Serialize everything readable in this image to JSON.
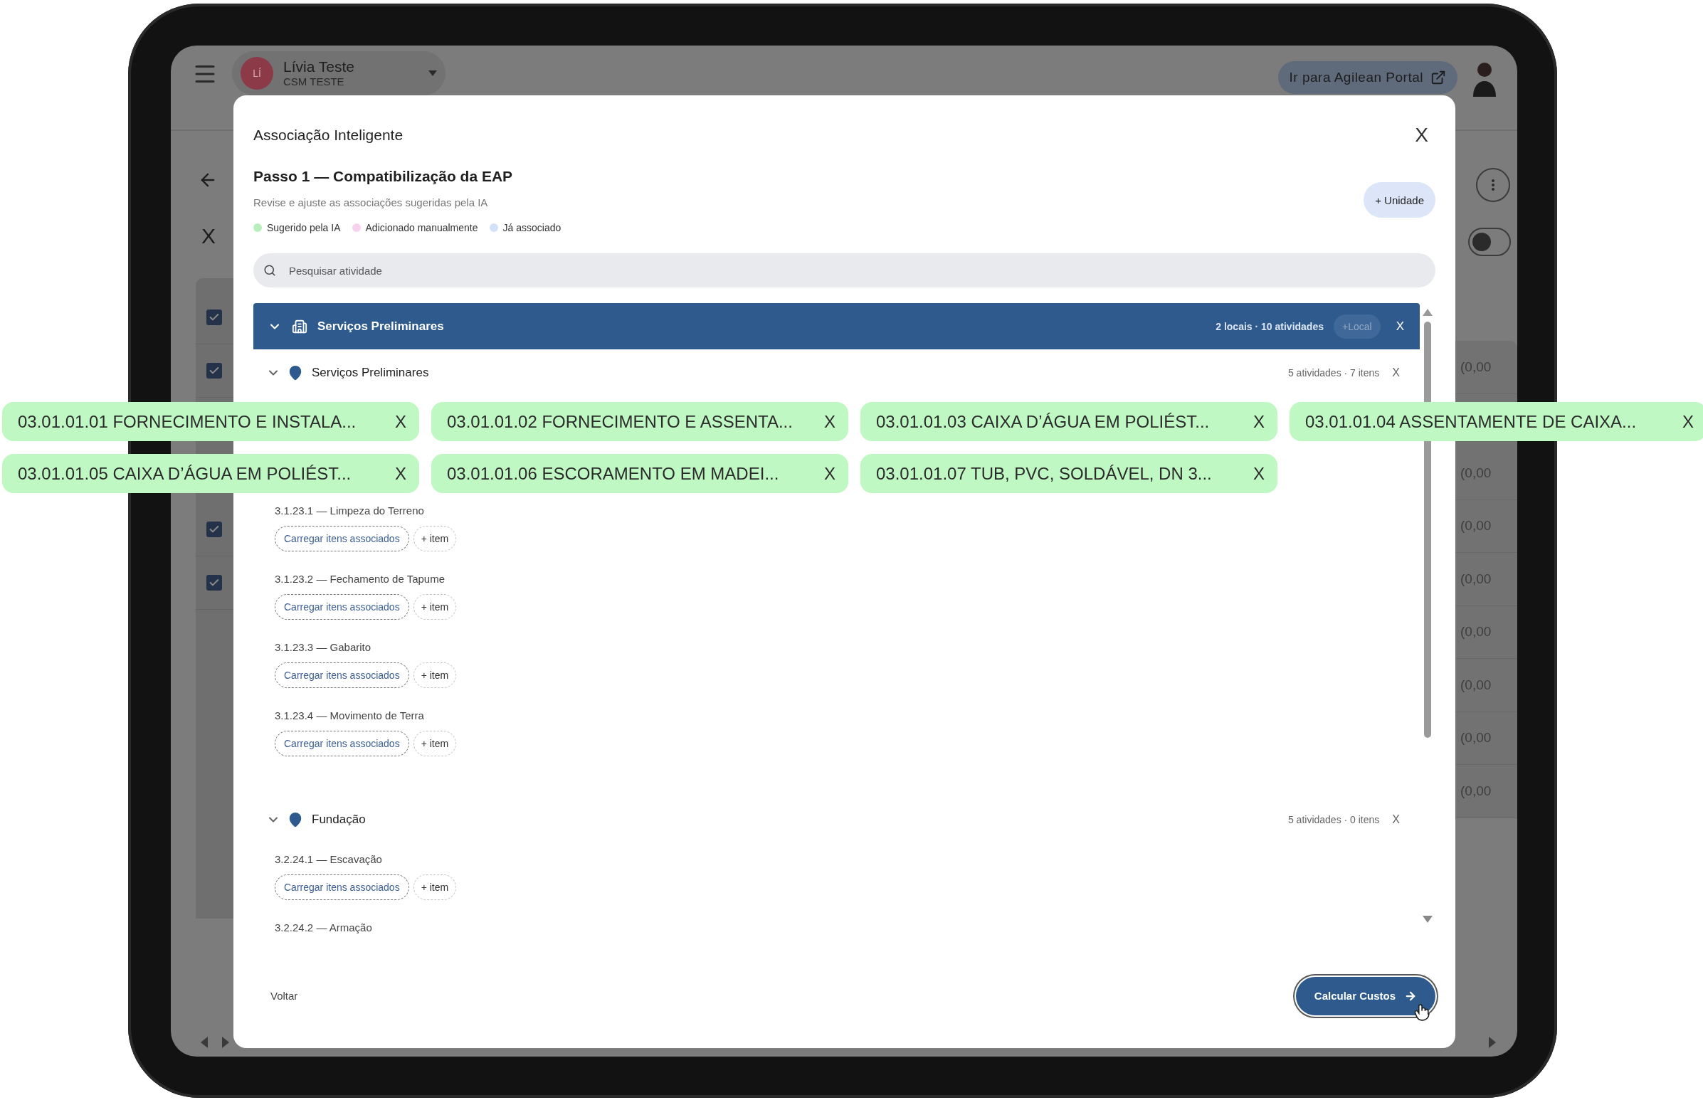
{
  "app_bar": {
    "user_initials": "LÍ",
    "user_name": "Lívia Teste",
    "user_org": "CSM TESTE",
    "portal_button": "Ir para Agilean Portal"
  },
  "background": {
    "close": "X",
    "toggle": {
      "on": false
    },
    "checked_rows": [
      {
        "checked": true
      },
      {
        "checked": true
      },
      {
        "checked": true
      },
      {
        "checked": true
      }
    ],
    "right_cells": [
      "(0,00",
      "(0,00",
      "(0,00",
      "(0,00",
      "(0,00",
      "(0,00",
      "(0,00",
      "(0,00"
    ]
  },
  "modal": {
    "title": "Associação Inteligente",
    "close": "X",
    "step_title": "Passo 1 — Compatibilização da EAP",
    "subtitle": "Revise e ajuste as associações sugeridas pela IA",
    "add_unit_button": "+ Unidade",
    "legend": [
      {
        "label": "Sugerido pela IA",
        "color": "#b8efbc"
      },
      {
        "label": "Adicionado manualmente",
        "color": "#f6d2ee"
      },
      {
        "label": "Já associado",
        "color": "#d2e0f8"
      }
    ],
    "search": {
      "placeholder": "Pesquisar atividade"
    },
    "group": {
      "title": "Serviços Preliminares",
      "expanded": true,
      "summary": "2 locais · 10 atividades",
      "add_local_button": "+Local",
      "remove": "X",
      "locations": [
        {
          "name": "Serviços Preliminares",
          "expanded": true,
          "summary": "5 atividades · 7 itens",
          "remove": "X",
          "activities": [
            {
              "label": "3.1.23.1 — Limpeza do Terreno",
              "load_button": "Carregar itens associados",
              "add_button": "+ item"
            },
            {
              "label": "3.1.23.2 — Fechamento de Tapume",
              "load_button": "Carregar itens associados",
              "add_button": "+ item"
            },
            {
              "label": "3.1.23.3 — Gabarito",
              "load_button": "Carregar itens associados",
              "add_button": "+ item"
            },
            {
              "label": "3.1.23.4 — Movimento de Terra",
              "load_button": "Carregar itens associados",
              "add_button": "+ item"
            }
          ]
        },
        {
          "name": "Fundação",
          "expanded": true,
          "summary": "5 atividades · 0 itens",
          "remove": "X",
          "activities": [
            {
              "label": "3.2.24.1 — Escavação",
              "load_button": "Carregar itens associados",
              "add_button": "+ item"
            },
            {
              "label": "3.2.24.2 — Armação"
            }
          ]
        }
      ]
    },
    "back_button": "Voltar",
    "primary_button": "Calcular Custos"
  },
  "suggested_chips": [
    {
      "label": "03.01.01.01 FORNECIMENTO E INSTALA...",
      "remove": "X"
    },
    {
      "label": "03.01.01.02 FORNECIMENTO E ASSENTA...",
      "remove": "X"
    },
    {
      "label": "03.01.01.03 CAIXA D’ÁGUA EM POLIÉST...",
      "remove": "X"
    },
    {
      "label": "03.01.01.04 ASSENTAMENTE DE CAIXA...",
      "remove": "X"
    },
    {
      "label": "03.01.01.05 CAIXA D’ÁGUA EM POLIÉST...",
      "remove": "X"
    },
    {
      "label": "03.01.01.06 ESCORAMENTO EM MADEI...",
      "remove": "X"
    },
    {
      "label": "03.01.01.07 TUB, PVC, SOLDÁVEL, DN 3...",
      "remove": "X"
    }
  ]
}
